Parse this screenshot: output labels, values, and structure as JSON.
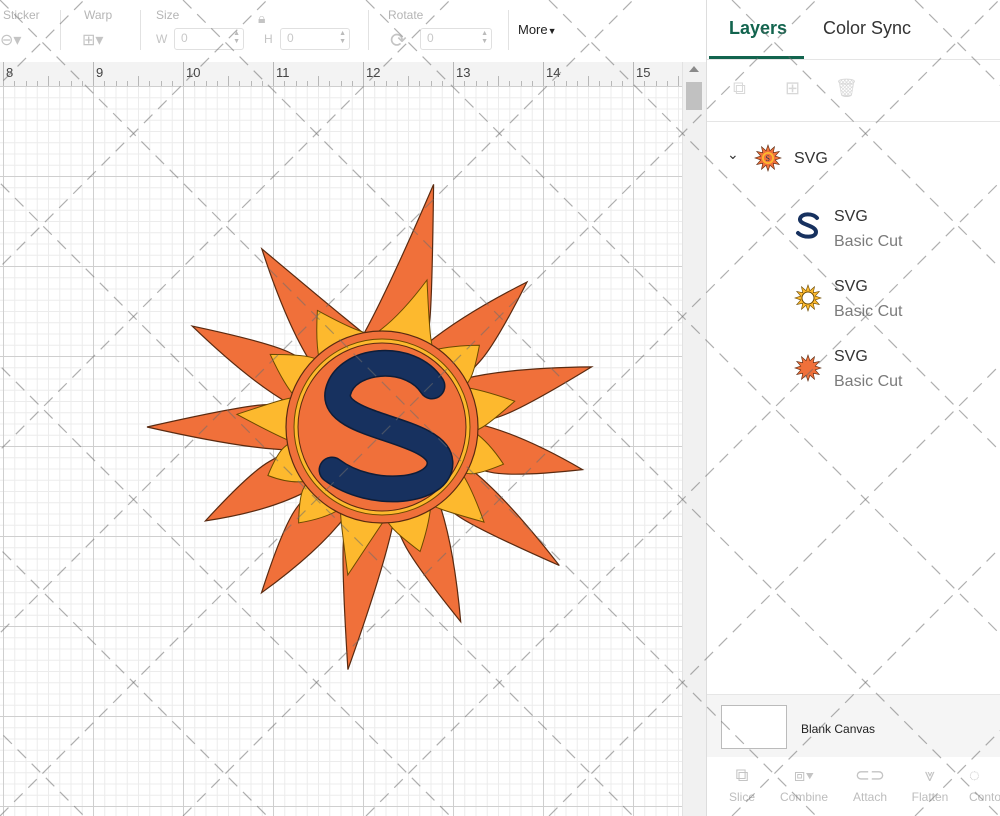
{
  "toolbar": {
    "sticker_label": "Sticker",
    "warp_label": "Warp",
    "size_label": "Size",
    "width_letter": "W",
    "width_value": "0",
    "height_letter": "H",
    "height_value": "0",
    "rotate_label": "Rotate",
    "rotate_value": "0",
    "more_label": "More"
  },
  "ruler": {
    "marks": [
      "8",
      "9",
      "10",
      "11",
      "12",
      "13",
      "14",
      "15"
    ]
  },
  "panel": {
    "tabs": {
      "layers": "Layers",
      "color_sync": "Color Sync"
    },
    "group": {
      "name": "SVG"
    },
    "layers": [
      {
        "name": "SVG",
        "type": "Basic Cut",
        "icon": "letter-s-icon"
      },
      {
        "name": "SVG",
        "type": "Basic Cut",
        "icon": "sun-ring-icon"
      },
      {
        "name": "SVG",
        "type": "Basic Cut",
        "icon": "sun-burst-icon"
      }
    ],
    "blank_canvas": "Blank Canvas",
    "actions": [
      "Slice",
      "Combine",
      "Attach",
      "Flatten",
      "Conto"
    ]
  },
  "colors": {
    "accent": "#12644e",
    "sun_orange": "#f0703a",
    "sun_yellow": "#fdb92e",
    "s_navy": "#17315f"
  }
}
